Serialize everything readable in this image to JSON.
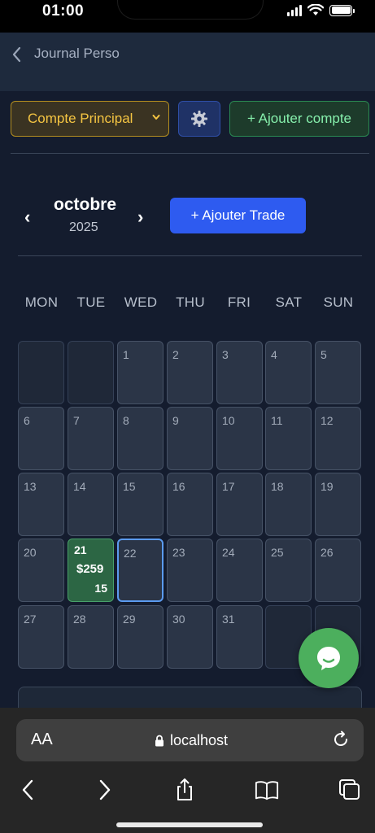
{
  "status_bar": {
    "time": "01:00"
  },
  "header": {
    "title": "Journal Perso"
  },
  "account": {
    "selected": "Compte Principal",
    "settings_icon": "gear-icon",
    "add_label": "+ Ajouter compte"
  },
  "calendar": {
    "month": "octobre",
    "year": "2025",
    "prev": "‹",
    "next": "›",
    "add_trade_label": "+ Ajouter Trade",
    "weekdays": [
      "MON",
      "TUE",
      "WED",
      "THU",
      "FRI",
      "SAT",
      "SUN"
    ],
    "days": [
      "1",
      "2",
      "3",
      "4",
      "5",
      "6",
      "7",
      "8",
      "9",
      "10",
      "11",
      "12",
      "13",
      "14",
      "15",
      "16",
      "17",
      "18",
      "19",
      "20",
      "21",
      "22",
      "23",
      "24",
      "25",
      "26",
      "27",
      "28",
      "29",
      "30",
      "31"
    ],
    "profit_day": {
      "day": "21",
      "amount": "$259",
      "count": "15"
    },
    "today": "22"
  },
  "browser": {
    "text_size_label": "AA",
    "url": "localhost"
  },
  "colors": {
    "background": "#141c2e",
    "account_accent": "#f5c542",
    "add_account_accent": "#86efac",
    "add_trade_bg": "#2e5bf0",
    "profit_cell": "#2c6644",
    "today_border": "#5b9bf0",
    "chat_fab": "#4caf5d"
  }
}
